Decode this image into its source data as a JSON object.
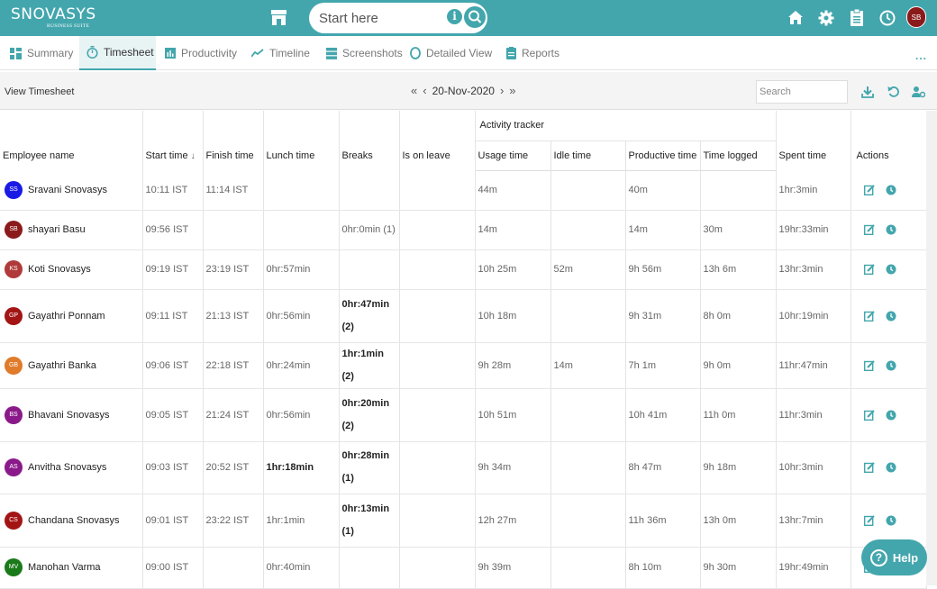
{
  "app": {
    "brand": "SNOVASYS",
    "brand_tag": "BUSINESS SUITE",
    "search_placeholder": "Start here",
    "user_initials": "SB",
    "accent_color": "#43a6ad"
  },
  "top_icons": [
    "store-icon",
    "home-icon",
    "gear-icon",
    "clipboard-icon",
    "clock-icon"
  ],
  "tabs": [
    {
      "label": "Summary",
      "icon": "grid-icon",
      "active": false
    },
    {
      "label": "Timesheet",
      "icon": "stopwatch-icon",
      "active": true
    },
    {
      "label": "Productivity",
      "icon": "bar-chart-icon",
      "active": false
    },
    {
      "label": "Timeline",
      "icon": "trend-line-icon",
      "active": false
    },
    {
      "label": "Screenshots",
      "icon": "screens-icon",
      "active": false
    },
    {
      "label": "Detailed View",
      "icon": "circle-icon",
      "active": false
    },
    {
      "label": "Reports",
      "icon": "report-icon",
      "active": false
    }
  ],
  "more_label": "...",
  "toolbar": {
    "title": "View Timesheet",
    "first": "«",
    "prev": "‹",
    "date": "20-Nov-2020",
    "next": "›",
    "last": "»",
    "search_placeholder": "Search"
  },
  "table": {
    "group_header": "Activity tracker",
    "columns": [
      "Employee name",
      "Start time",
      "Finish time",
      "Lunch time",
      "Breaks",
      "Is on leave",
      "Usage time",
      "Idle time",
      "Productive time",
      "Time logged",
      "Spent time",
      "Actions"
    ],
    "sort_indicator": "↓",
    "rows": [
      {
        "initials": "SS",
        "color": "#1a1ae6",
        "name": "Sravani Snovasys",
        "start": "10:11 IST",
        "finish": "11:14 IST",
        "lunch": "",
        "breaks": "",
        "leave": "",
        "usage": "44m",
        "idle": "",
        "productive": "40m",
        "logged": "",
        "spent": "1hr:3min"
      },
      {
        "initials": "SB",
        "color": "#8b1a1a",
        "name": "shayari Basu",
        "start": "09:56 IST",
        "finish": "",
        "lunch": "",
        "breaks": "0hr:0min (1)",
        "leave": "",
        "usage": "14m",
        "idle": "",
        "productive": "14m",
        "logged": "30m",
        "spent": "19hr:33min"
      },
      {
        "initials": "KS",
        "color": "#b03a3a",
        "name": "Koti Snovasys",
        "start": "09:19 IST",
        "finish": "23:19 IST",
        "lunch": "0hr:57min",
        "breaks": "",
        "leave": "",
        "usage": "10h 25m",
        "idle": "52m",
        "productive": "9h 56m",
        "logged": "13h 6m",
        "spent": "13hr:3min"
      },
      {
        "initials": "GP",
        "color": "#a31515",
        "name": "Gayathri Ponnam",
        "start": "09:11 IST",
        "finish": "21:13 IST",
        "lunch": "0hr:56min",
        "breaks": "0hr:47min (2)",
        "leave": "",
        "usage": "10h 18m",
        "idle": "",
        "productive": "9h 31m",
        "logged": "8h 0m",
        "spent": "10hr:19min"
      },
      {
        "initials": "GB",
        "color": "#e07b2a",
        "name": "Gayathri Banka",
        "start": "09:06 IST",
        "finish": "22:18 IST",
        "lunch": "0hr:24min",
        "breaks": "1hr:1min (2)",
        "leave": "",
        "usage": "9h 28m",
        "idle": "14m",
        "productive": "7h 1m",
        "logged": "9h 0m",
        "spent": "11hr:47min"
      },
      {
        "initials": "BS",
        "color": "#8a1a8a",
        "name": "Bhavani Snovasys",
        "start": "09:05 IST",
        "finish": "21:24 IST",
        "lunch": "0hr:56min",
        "breaks": "0hr:20min (2)",
        "leave": "",
        "usage": "10h 51m",
        "idle": "",
        "productive": "10h 41m",
        "logged": "11h 0m",
        "spent": "11hr:3min"
      },
      {
        "initials": "AS",
        "color": "#8a1a8a",
        "name": "Anvitha Snovasys",
        "start": "09:03 IST",
        "finish": "20:52 IST",
        "lunch": "1hr:18min",
        "breaks": "0hr:28min (1)",
        "leave": "",
        "usage": "9h 34m",
        "idle": "",
        "productive": "8h 47m",
        "logged": "9h 18m",
        "spent": "10hr:3min"
      },
      {
        "initials": "CS",
        "color": "#a31515",
        "name": "Chandana Snovasys",
        "start": "09:01 IST",
        "finish": "23:22 IST",
        "lunch": "1hr:1min",
        "breaks": "0hr:13min (1)",
        "leave": "",
        "usage": "12h 27m",
        "idle": "",
        "productive": "11h 36m",
        "logged": "13h 0m",
        "spent": "13hr:7min"
      },
      {
        "initials": "MV",
        "color": "#1a7a1a",
        "name": "Manohan Varma",
        "start": "09:00 IST",
        "finish": "",
        "lunch": "0hr:40min",
        "breaks": "",
        "leave": "",
        "usage": "9h 39m",
        "idle": "",
        "productive": "8h 10m",
        "logged": "9h 30m",
        "spent": "19hr:49min"
      }
    ]
  },
  "help": {
    "icon": "?",
    "label": "Help"
  }
}
